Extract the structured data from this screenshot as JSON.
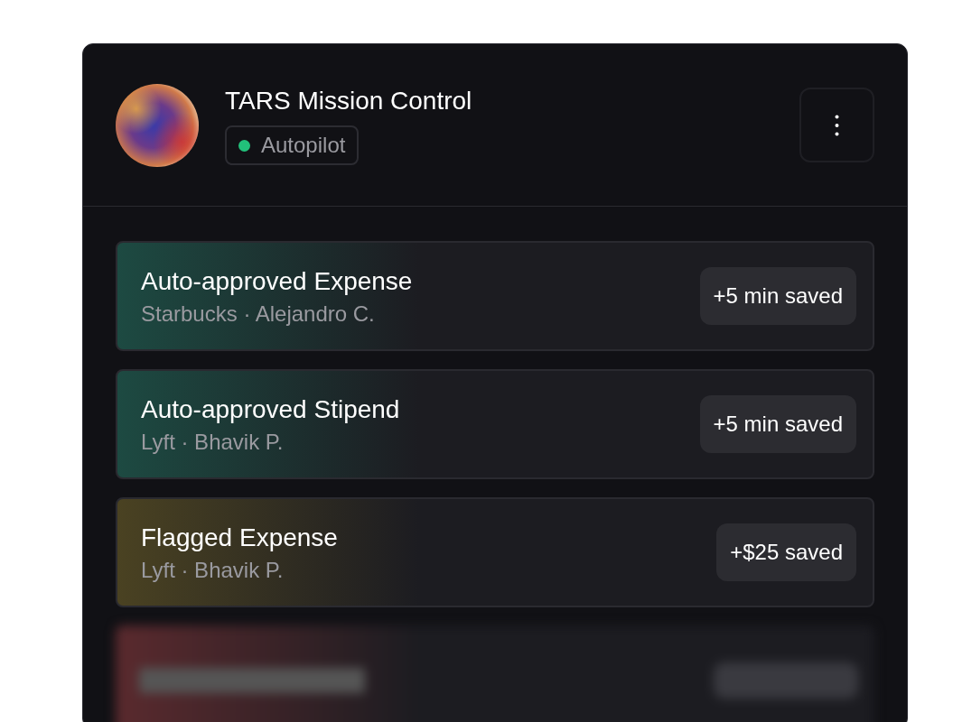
{
  "header": {
    "title": "TARS Mission Control",
    "status": {
      "label": "Autopilot",
      "color": "#22c07a"
    }
  },
  "items": [
    {
      "kind": "entry",
      "title": "Auto-approved Expense",
      "subtitle": "Starbucks · Alejandro C.",
      "saving": "+5 min saved",
      "color": "#1d4a42"
    },
    {
      "kind": "entry",
      "title": "Auto-approved Stipend",
      "subtitle": "Lyft · Bhavik P.",
      "saving": "+5 min saved",
      "color": "#1d4a42"
    },
    {
      "kind": "entry",
      "title": "Flagged Expense",
      "subtitle": "Lyft · Bhavik P.",
      "saving": "+$25 saved",
      "color": "#4a4222"
    },
    {
      "kind": "blurred",
      "color": "#5a2a2e"
    }
  ]
}
